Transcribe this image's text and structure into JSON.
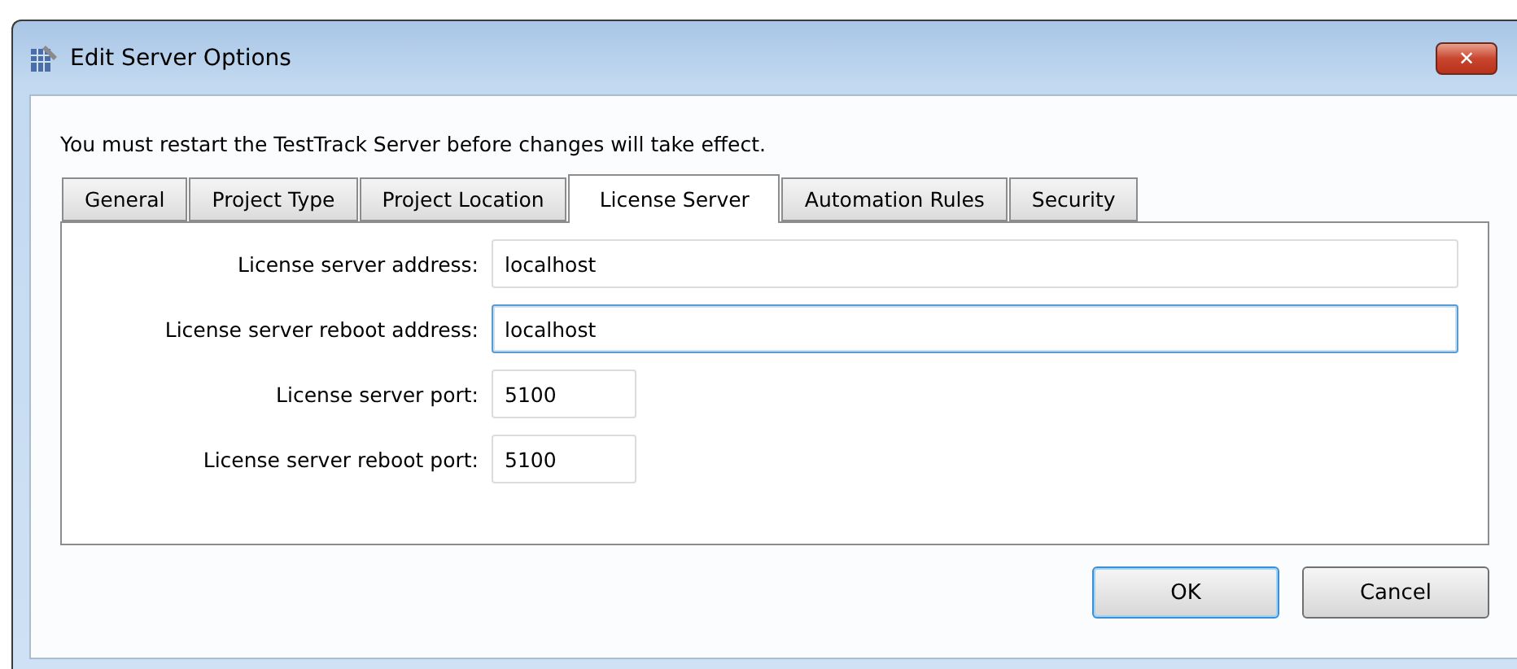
{
  "window": {
    "title": "Edit Server Options",
    "close": "✕"
  },
  "notice": "You must restart the TestTrack Server before changes will take effect.",
  "tabs": [
    {
      "label": "General",
      "selected": false
    },
    {
      "label": "Project Type",
      "selected": false
    },
    {
      "label": "Project Location",
      "selected": false
    },
    {
      "label": "License Server",
      "selected": true
    },
    {
      "label": "Automation Rules",
      "selected": false
    },
    {
      "label": "Security",
      "selected": false
    }
  ],
  "fields": [
    {
      "label": "License server address:",
      "value": "localhost",
      "kind": "wide",
      "focused": false
    },
    {
      "label": "License server reboot address:",
      "value": "localhost",
      "kind": "wide",
      "focused": true
    },
    {
      "label": "License server port:",
      "value": "5100",
      "kind": "short",
      "focused": false
    },
    {
      "label": "License server reboot port:",
      "value": "5100",
      "kind": "short",
      "focused": false
    }
  ],
  "buttons": [
    {
      "label": "OK",
      "default": true
    },
    {
      "label": "Cancel",
      "default": false
    }
  ]
}
